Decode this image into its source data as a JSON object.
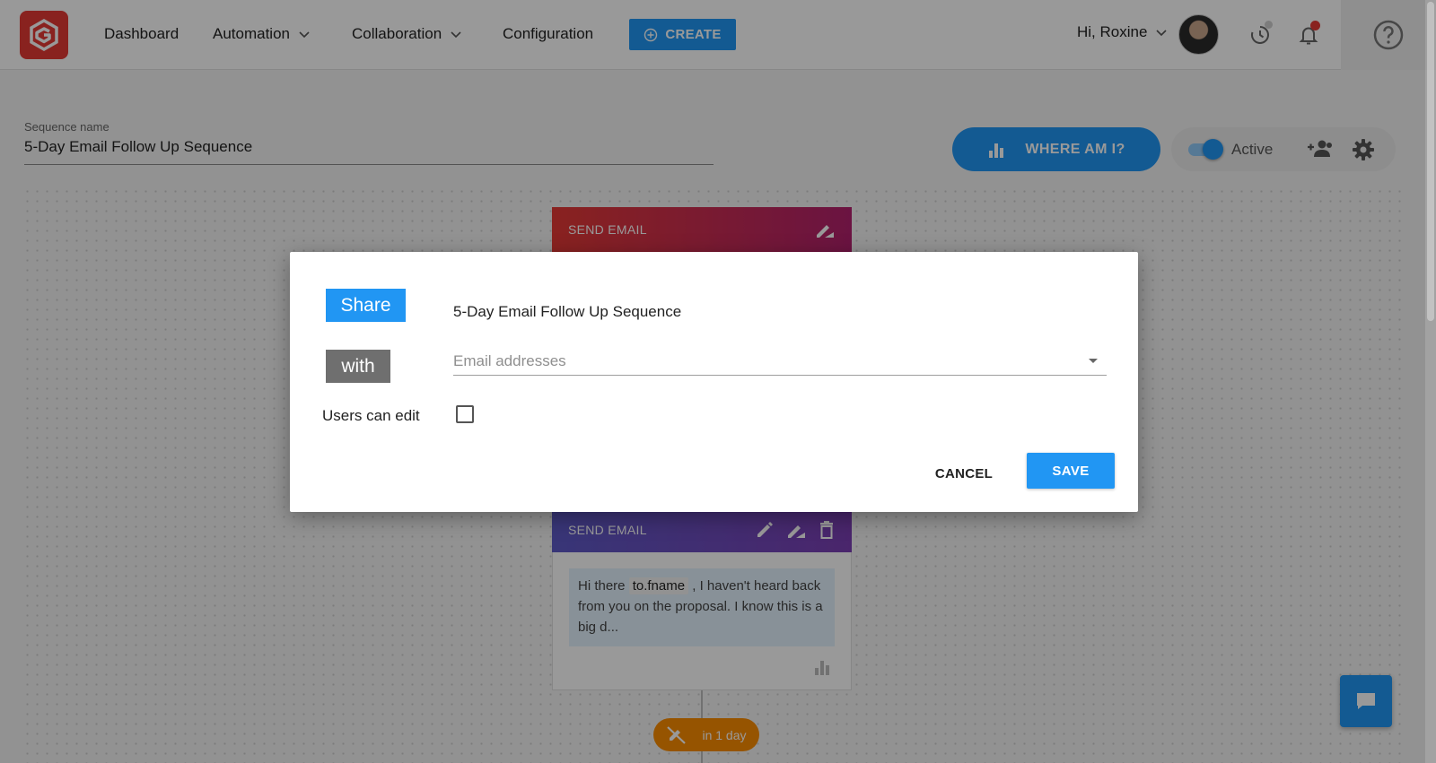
{
  "nav": {
    "items": [
      {
        "label": "Dashboard"
      },
      {
        "label": "Automation"
      },
      {
        "label": "Collaboration"
      },
      {
        "label": "Configuration"
      }
    ],
    "create_label": "CREATE",
    "greeting": "Hi, Roxine"
  },
  "sequence": {
    "name_label": "Sequence name",
    "name_value": "5-Day Email Follow Up Sequence",
    "where_am_i_label": "WHERE AM I?",
    "active_label": "Active",
    "active": true
  },
  "canvas": {
    "top_card": {
      "title": "SEND EMAIL"
    },
    "mid_card": {
      "title": "SEND EMAIL",
      "preview_start": "Hi there ",
      "preview_tag": "to.fname",
      "preview_rest": " ,   I haven't heard back from you on the proposal. I know this is a big d..."
    },
    "delay_label": "in 1 day"
  },
  "modal": {
    "share_label": "Share",
    "with_label": "with",
    "title": "5-Day Email Follow Up Sequence",
    "email_placeholder": "Email addresses",
    "users_can_edit_label": "Users can edit",
    "users_can_edit": false,
    "cancel_label": "CANCEL",
    "save_label": "SAVE"
  },
  "colors": {
    "accent": "#2196f3",
    "logo": "#e53935",
    "delay": "#fb8c00"
  }
}
